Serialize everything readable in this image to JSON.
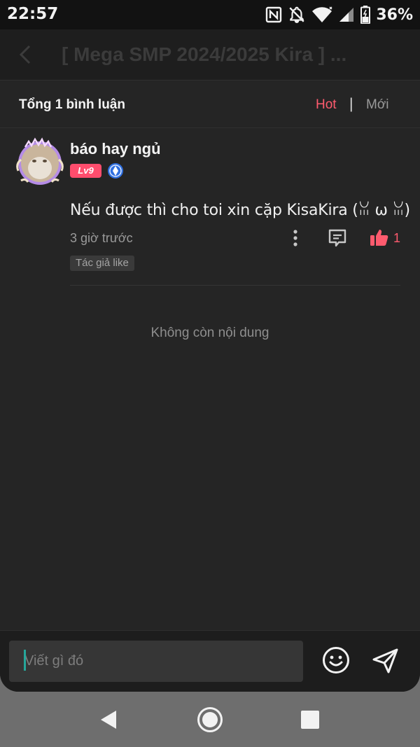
{
  "status_bar": {
    "time": "22:57",
    "battery_percent": "36%",
    "icons": [
      "nfc-icon",
      "notifications-off-icon",
      "wifi-icon",
      "cell-signal-icon",
      "battery-icon"
    ]
  },
  "header": {
    "title": "[ Mega SMP 2024/2025 Kira ] ...",
    "back_icon": "chevron-left-icon"
  },
  "sort_bar": {
    "total_label": "Tổng 1 bình luận",
    "hot_label": "Hot",
    "separator": "|",
    "new_label": "Mới",
    "active": "Hot"
  },
  "comments": [
    {
      "username": "báo hay ngủ",
      "level": "Lv9",
      "text": "Nếu được thì cho toi xin cặp KisaKira (ꈍ ω ꈍ)",
      "time": "3 giờ trước",
      "likes": "1",
      "tag": "Tác giả like"
    }
  ],
  "empty_state": "Không còn nội dung",
  "input": {
    "placeholder": "Viết gì đó"
  },
  "colors": {
    "accent": "#ff5b6e",
    "background": "#252525",
    "level_badge": "#ff4d6d",
    "verify_badge": "#2f6fe0",
    "cursor": "#26a69a"
  }
}
